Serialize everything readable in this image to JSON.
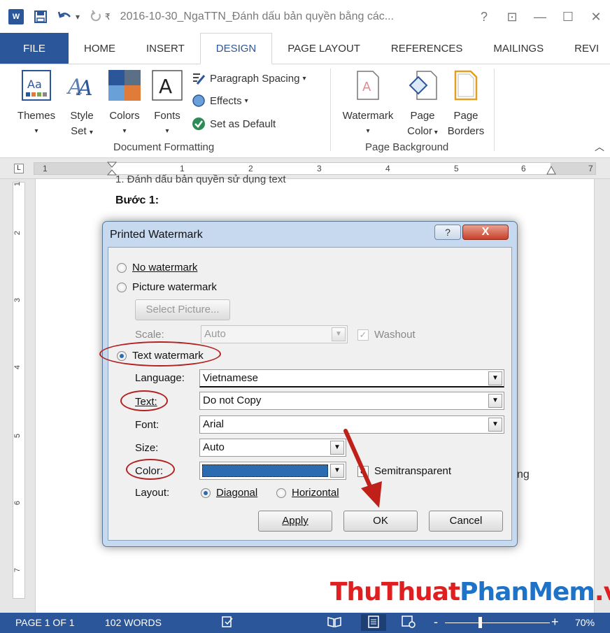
{
  "titlebar": {
    "app_icon": "W",
    "title": "2016-10-30_NgaTTN_Đánh dấu bản quyền bằng các...",
    "help": "?",
    "restore_ribbon": "⊡",
    "minimize": "—",
    "maximize": "☐",
    "close": "✕"
  },
  "tabs": [
    "FILE",
    "HOME",
    "INSERT",
    "DESIGN",
    "PAGE LAYOUT",
    "REFERENCES",
    "MAILINGS",
    "REVI"
  ],
  "active_tab": "DESIGN",
  "ribbon": {
    "themes": "Themes",
    "style_set_1": "Style",
    "style_set_2": "Set",
    "colors": "Colors",
    "fonts": "Fonts",
    "paragraph_spacing": "Paragraph Spacing",
    "effects": "Effects",
    "set_as_default": "Set as Default",
    "group_document_formatting": "Document Formatting",
    "watermark": "Watermark",
    "page_color_1": "Page",
    "page_color_2": "Color",
    "page_borders_1": "Page",
    "page_borders_2": "Borders",
    "group_page_background": "Page Background"
  },
  "ruler": {
    "corner": "L",
    "numbers": [
      "1",
      "1",
      "2",
      "3",
      "4",
      "5",
      "6",
      "7"
    ],
    "vnumbers": [
      "1",
      "2",
      "3",
      "4",
      "5",
      "6",
      "7"
    ]
  },
  "document": {
    "cut_line": "1. Đánh dấu bản quyền sử dụng text",
    "step": "Bước 1:",
    "tail": "ng"
  },
  "dialog": {
    "title": "Printed Watermark",
    "help": "?",
    "close": "X",
    "no_watermark": "No watermark",
    "picture_watermark": "Picture watermark",
    "select_picture": "Select Picture...",
    "scale_label": "Scale:",
    "scale_value": "Auto",
    "washout": "Washout",
    "text_watermark": "Text watermark",
    "language_label": "Language:",
    "language_value": "Vietnamese",
    "text_label": "Text:",
    "text_value": "Do not Copy",
    "font_label": "Font:",
    "font_value": "Arial",
    "size_label": "Size:",
    "size_value": "Auto",
    "color_label": "Color:",
    "color_value": "#2b6cb0",
    "semitransparent": "Semitransparent",
    "layout_label": "Layout:",
    "diagonal": "Diagonal",
    "horizontal": "Horizontal",
    "apply": "Apply",
    "ok": "OK",
    "cancel": "Cancel"
  },
  "brand": {
    "part1": "ThuThuat",
    "part2": "PhanMem",
    "part3": ".vn"
  },
  "statusbar": {
    "page": "PAGE 1 OF 1",
    "words": "102 WORDS",
    "zoom": "70%",
    "zoom_minus": "-",
    "zoom_plus": "+"
  },
  "colors": {
    "accent": "#2b579a",
    "annotation": "#b22222",
    "swatch": "#2b6cb0"
  }
}
